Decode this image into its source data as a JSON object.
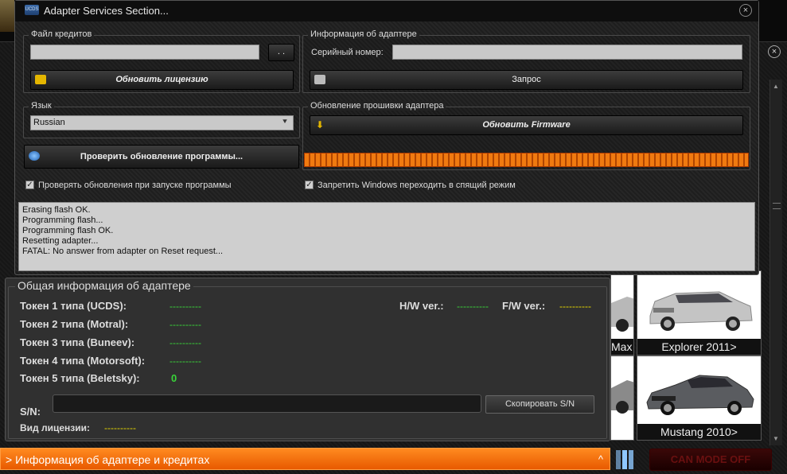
{
  "dialog": {
    "title": "Adapter Services Section...",
    "icon_text": "UCDS",
    "close_glyph": "×"
  },
  "credits": {
    "label": "Файл кредитов",
    "browse_label": ". .",
    "update_license_label": "Обновить лицензию"
  },
  "adapter_info": {
    "label": "Информация об адаптере",
    "serial_label": "Серийный номер:",
    "request_label": "Запрос"
  },
  "language": {
    "label": "Язык",
    "selected": "Russian"
  },
  "firmware": {
    "label": "Обновление прошивки адаптера",
    "update_label": "Обновить Firmware",
    "progress": 1.0
  },
  "check_update_label": "Проверить обновление программы...",
  "checkboxes": {
    "check_on_start": "Проверять обновления при запуске программы",
    "prevent_sleep": "Запретить Windows переходить в спящий режим"
  },
  "log": [
    "Erasing flash OK.",
    "Programming flash...",
    "Programming flash OK.",
    "Resetting adapter...",
    "FATAL: No answer from adapter on Reset request..."
  ],
  "info_panel": {
    "title": "Общая информация об адаптере",
    "tokens": [
      {
        "label": "Токен 1 типа (UCDS):",
        "value": "----------"
      },
      {
        "label": "Токен 2 типа (Motral):",
        "value": "----------"
      },
      {
        "label": "Токен 3 типа (Buneev):",
        "value": "----------"
      },
      {
        "label": "Токен 4 типа (Motorsoft):",
        "value": "----------"
      },
      {
        "label": "Токен 5 типа (Beletsky):",
        "value": "0"
      }
    ],
    "hw_label": "H/W ver.:",
    "hw_value": "----------",
    "fw_label": "F/W ver.:",
    "fw_value": "----------",
    "sn_label": "S/N:",
    "copy_label": "Скопировать S/N",
    "license_label": "Вид лицензии:",
    "license_value": "----------"
  },
  "bottom_bar": {
    "label": "> Информация об адаптере и кредитах",
    "chevron": "^"
  },
  "background": {
    "cards": [
      "Explorer 2011>",
      "Mustang 2010>"
    ],
    "partial_cards": [
      "Max",
      ""
    ],
    "can_mode": "CAN MODE OFF"
  },
  "colors": {
    "accent_orange": "#f07a10",
    "dash_green": "#39d439",
    "dash_yellow": "#e8d800"
  }
}
